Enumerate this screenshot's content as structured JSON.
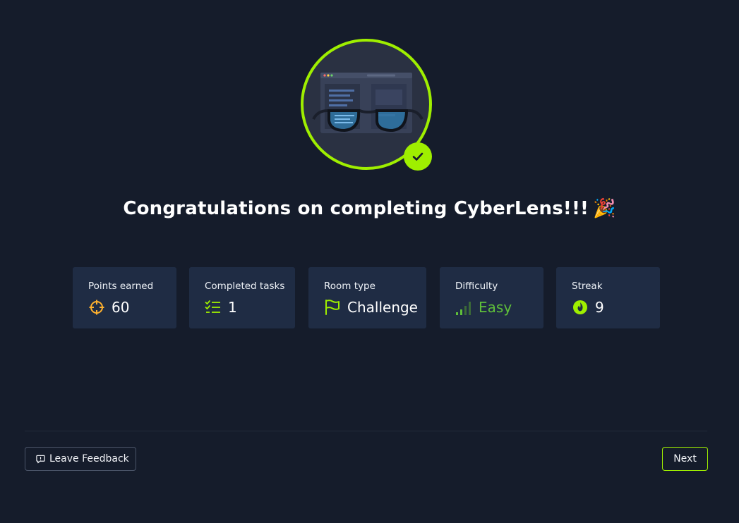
{
  "title": {
    "text": "Congratulations on completing CyberLens!!!",
    "emoji": "🎉"
  },
  "badge": {
    "image_icon": "glasses-over-code-icon",
    "status_icon": "check-icon"
  },
  "stats": [
    {
      "label": "Points earned",
      "value": "60",
      "icon": "crosshair-icon"
    },
    {
      "label": "Completed tasks",
      "value": "1",
      "icon": "checklist-icon"
    },
    {
      "label": "Room type",
      "value": "Challenge",
      "icon": "flag-icon"
    },
    {
      "label": "Difficulty",
      "value": "Easy",
      "icon": "signal-bars-icon"
    },
    {
      "label": "Streak",
      "value": "9",
      "icon": "flame-icon"
    }
  ],
  "footer": {
    "feedback_label": "Leave Feedback",
    "next_label": "Next"
  },
  "colors": {
    "background": "#151c2b",
    "card": "#1f2c44",
    "accent": "#9fef00",
    "points_icon": "#ffb12e",
    "easy": "#5fbf3a"
  }
}
